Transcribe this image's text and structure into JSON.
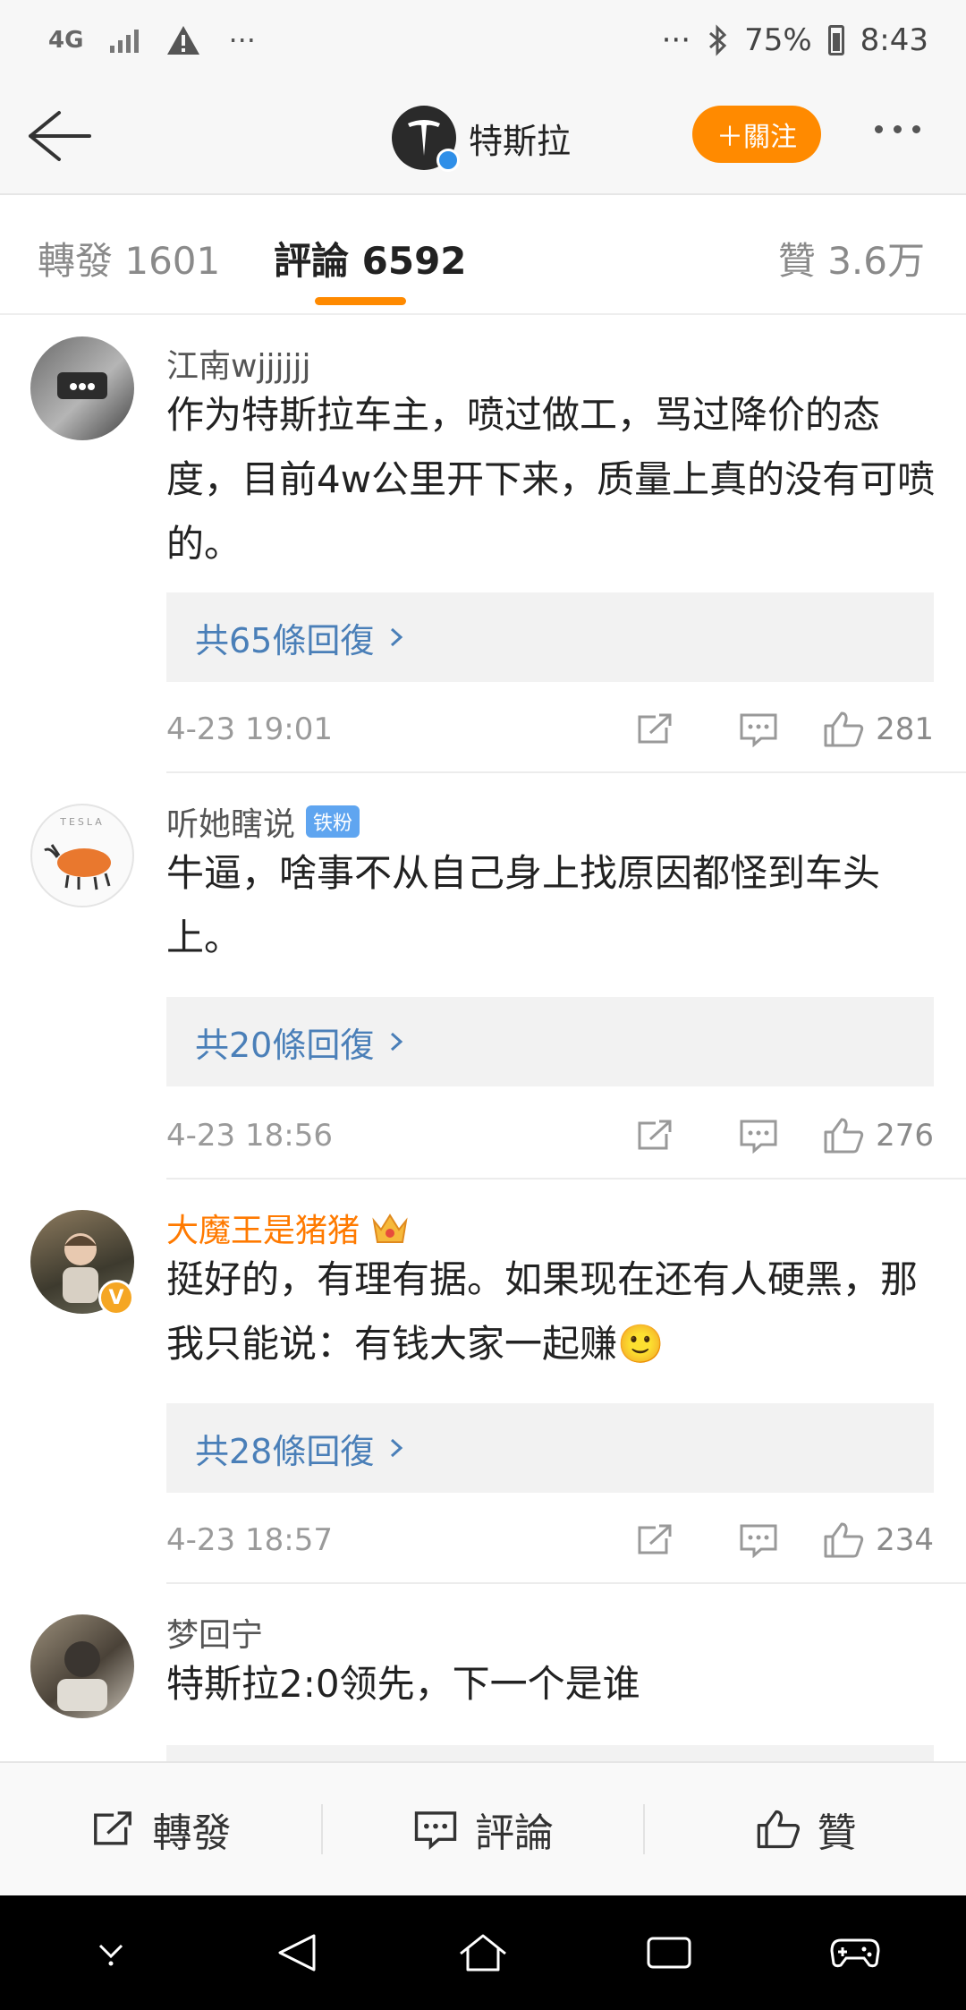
{
  "status_bar": {
    "network": "4G",
    "dots_left": "···",
    "dots_right": "···",
    "battery": "75%",
    "time": "8:43"
  },
  "header": {
    "title": "特斯拉",
    "follow_label": "＋關注"
  },
  "tabs": [
    {
      "label": "轉發 1601",
      "active": false
    },
    {
      "label": "評論 6592",
      "active": true
    },
    {
      "label": "贊 3.6万",
      "active": false
    }
  ],
  "comments": [
    {
      "username": "江南wjjjjjj",
      "text": "作为特斯拉车主，喷过做工，骂过降价的态度，目前4w公里开下来，质量上真的没有可喷的。",
      "replies": "共65條回復",
      "time": "4-23 19:01",
      "likes": "281"
    },
    {
      "username": "听她瞎说",
      "tag": "铁粉",
      "avatar_caption": "TESLA",
      "text": "牛逼，啥事不从自己身上找原因都怪到车头上。",
      "replies": "共20條回復",
      "time": "4-23 18:56",
      "likes": "276"
    },
    {
      "username": "大魔王是猪猪",
      "text": "挺好的，有理有据。如果现在还有人硬黑，那我只能说：有钱大家一起赚",
      "emoji": "🙂",
      "replies": "共28條回復",
      "time": "4-23 18:57",
      "likes": "234"
    },
    {
      "username": "梦回宁",
      "text": "特斯拉2:0领先，下一个是谁"
    }
  ],
  "bottom_bar": {
    "forward": "轉發",
    "comment": "評論",
    "like": "贊"
  },
  "colors": {
    "accent": "#ff8a00",
    "link": "#4a7fb8",
    "verified": "#2f8fe8"
  }
}
